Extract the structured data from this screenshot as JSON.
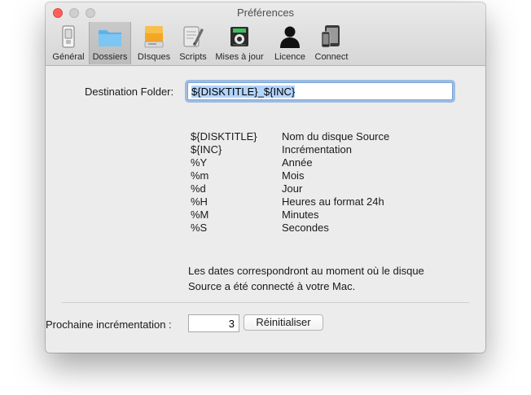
{
  "window": {
    "title": "Préférences"
  },
  "toolbar": {
    "tabs": [
      {
        "label": "Général",
        "icon": "switch-icon",
        "selected": false
      },
      {
        "label": "Dossiers",
        "icon": "folder-icon",
        "selected": true
      },
      {
        "label": "DIsques",
        "icon": "disk-icon",
        "selected": false
      },
      {
        "label": "Scripts",
        "icon": "script-icon",
        "selected": false
      },
      {
        "label": "Mises à jour",
        "icon": "update-icon",
        "selected": false
      },
      {
        "label": "Licence",
        "icon": "person-icon",
        "selected": false
      },
      {
        "label": "Connect",
        "icon": "devices-icon",
        "selected": false
      }
    ]
  },
  "destination": {
    "label": "Destination Folder:",
    "value": "${DISKTITLE}_${INC}"
  },
  "legend": [
    {
      "code": "${DISKTITLE}",
      "desc": "Nom du disque Source"
    },
    {
      "code": "${INC}",
      "desc": "Incrémentation"
    },
    {
      "code": "%Y",
      "desc": "Année"
    },
    {
      "code": "%m",
      "desc": "Mois"
    },
    {
      "code": "%d",
      "desc": "Jour"
    },
    {
      "code": "%H",
      "desc": "Heures au format 24h"
    },
    {
      "code": "%M",
      "desc": "Minutes"
    },
    {
      "code": "%S",
      "desc": "Secondes"
    }
  ],
  "note": {
    "line1": "Les dates correspondront au moment où le disque",
    "line2": "Source a été connecté à votre Mac."
  },
  "increment": {
    "label": "Prochaine incrémentation :",
    "value": "3",
    "reset_label": "Réinitialiser"
  },
  "colors": {
    "close": "#fc605c",
    "selection": "#b3d4fc",
    "focus_ring": "#5f96dc"
  }
}
